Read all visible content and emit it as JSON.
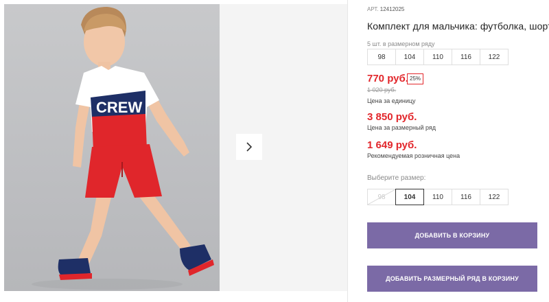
{
  "product": {
    "article_label": "АРТ.",
    "article_number": "12412025",
    "title": "Комплект для мальчика: футболка, шорты"
  },
  "size_range": {
    "caption": "5 шт. в размерном ряду",
    "sizes": [
      "98",
      "104",
      "110",
      "116",
      "122"
    ]
  },
  "pricing": {
    "unit_price": "770 руб.",
    "discount": "25%",
    "old_price": "1 020 руб.",
    "unit_label": "Цена за единицу",
    "row_price": "3 850 руб.",
    "row_label": "Цена за размерный ряд",
    "retail_price": "1 649 руб.",
    "retail_label": "Рекомендуемая розничная цена"
  },
  "size_select": {
    "label": "Выберите размер:",
    "sizes": [
      "98",
      "104",
      "110",
      "116",
      "122"
    ],
    "selected": "104",
    "unavailable": [
      "98"
    ]
  },
  "buttons": {
    "add_to_cart": "Добавить в корзину",
    "add_row_to_cart": "Добавить размерный ряд в корзину"
  },
  "photo": {
    "shirt_print": "CREW"
  },
  "icons": {
    "next": "chevron-right-icon"
  },
  "colors": {
    "price_red": "#e2262b",
    "button_purple": "#7b6aa6"
  }
}
